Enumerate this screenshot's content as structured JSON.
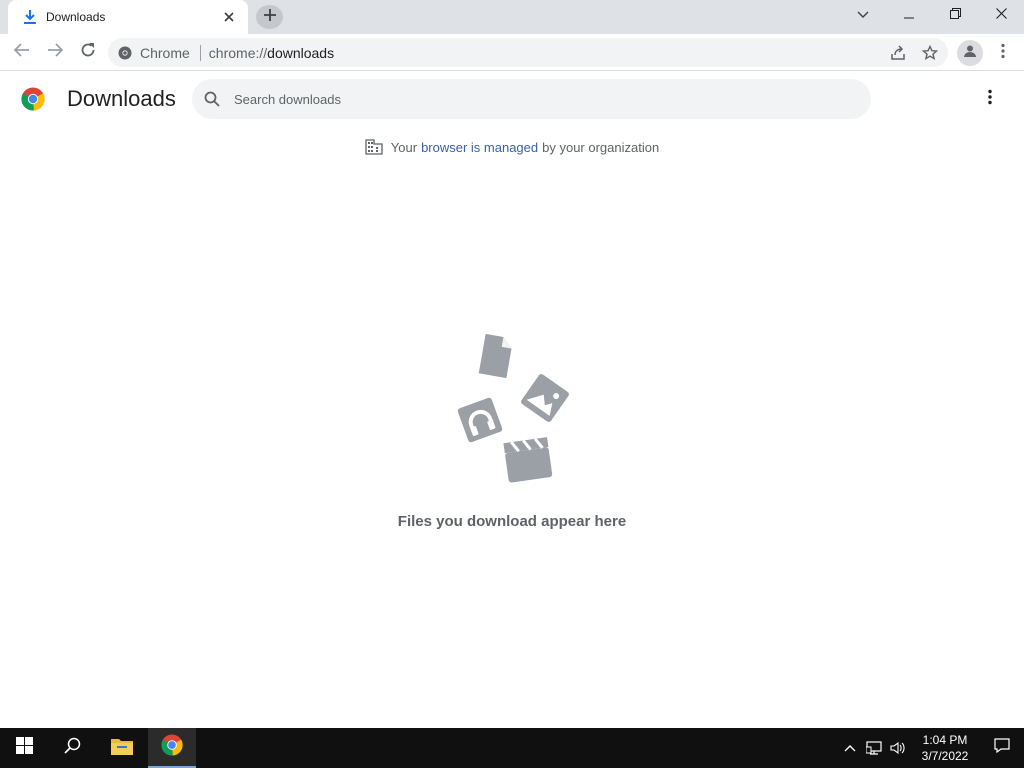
{
  "tab": {
    "title": "Downloads"
  },
  "toolbar": {
    "site_label": "Chrome",
    "url_scheme": "chrome://",
    "url_host": "downloads"
  },
  "page": {
    "title": "Downloads",
    "search_placeholder": "Search downloads",
    "managed_prefix": "Your",
    "managed_link": "browser is managed",
    "managed_suffix": "by your organization",
    "empty_text": "Files you download appear here"
  },
  "taskbar": {
    "time": "1:04 PM",
    "date": "3/7/2022"
  },
  "icons": {
    "tab_favicon": "download-icon",
    "tab_close": "close-icon",
    "new_tab": "plus-icon",
    "back": "arrow-left-icon",
    "forward": "arrow-right-icon",
    "reload": "reload-icon",
    "share": "share-icon",
    "bookmark": "star-icon",
    "profile": "person-icon",
    "menu": "kebab-icon",
    "search": "search-icon",
    "managed": "building-icon"
  },
  "colors": {
    "accent_link": "#3b5fa9",
    "tab_strip": "#dee1e6",
    "omnibox": "#f1f3f4",
    "taskbar": "#101010",
    "illustration": "#9aa0a6"
  }
}
